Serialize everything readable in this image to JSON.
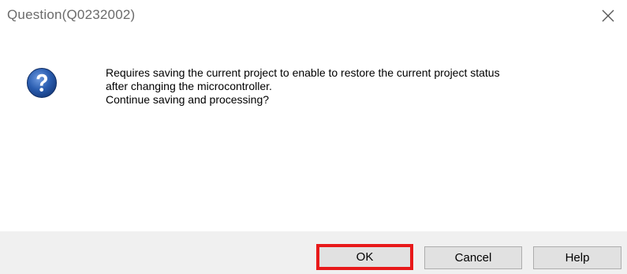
{
  "dialog": {
    "title": "Question(Q0232002)",
    "icon": "question-icon",
    "message_lines": [
      "Requires saving the current project to enable to restore the current project status",
      "after changing the microcontroller.",
      "Continue saving and processing?"
    ]
  },
  "buttons": {
    "ok_label": "OK",
    "cancel_label": "Cancel",
    "help_label": "Help"
  },
  "colors": {
    "highlight": "#e8191a",
    "icon_blue": "#2a5db0",
    "footer_bg": "#f0f0f0",
    "button_bg": "#e1e1e1"
  }
}
